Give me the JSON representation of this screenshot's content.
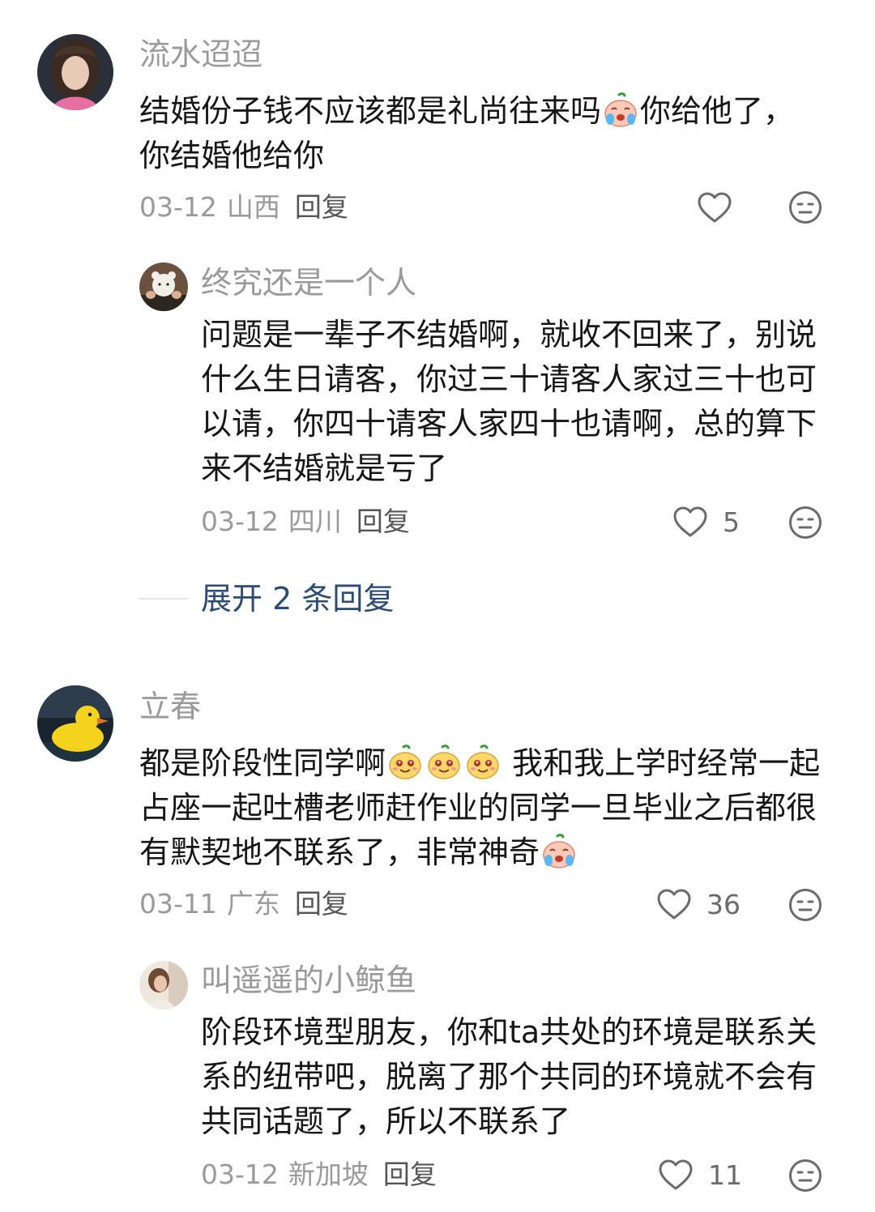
{
  "comments": [
    {
      "author": "流水迢迢",
      "text_a": "结婚份子钱不应该都是礼尚往来吗",
      "text_b": "你给他了，你结婚他给你",
      "date": "03-12",
      "location": "山西",
      "reply_label": "回复",
      "likes": "",
      "avatar_icon": "avatar-woman-portrait",
      "replies": [
        {
          "author": "终究还是一个人",
          "text": "问题是一辈子不结婚啊，就收不回来了，别说什么生日请客，你过三十请客人家过三十也可以请，你四十请客人家四十也请啊，总的算下来不结婚就是亏了",
          "date": "03-12",
          "location": "四川",
          "reply_label": "回复",
          "likes": "5",
          "avatar_icon": "avatar-bear-toy"
        }
      ],
      "expand_label": "展开 2 条回复"
    },
    {
      "author": "立春",
      "text_a": "都是阶段性同学啊",
      "text_b": " 我和我上学时经常一起占座一起吐槽老师赶作业的同学一旦毕业之后都很有默契地不联系了，非常神奇",
      "date": "03-11",
      "location": "广东",
      "reply_label": "回复",
      "likes": "36",
      "avatar_icon": "avatar-rubber-duck",
      "replies": [
        {
          "author": "叫遥遥的小鲸鱼",
          "text": "阶段环境型朋友，你和ta共处的环境是联系关系的纽带吧，脱离了那个共同的环境就不会有共同话题了，所以不联系了",
          "date": "03-12",
          "location": "新加坡",
          "reply_label": "回复",
          "likes": "11",
          "avatar_icon": "avatar-person-photo"
        }
      ]
    }
  ],
  "icons": {
    "like": "heart-outline-icon",
    "dislike": "meh-face-icon",
    "emoji_cry": "crying-peach-emoji-icon",
    "emoji_sly": "smirk-peach-emoji-icon"
  },
  "colors": {
    "name": "#9a9a9a",
    "text": "#161616",
    "link": "#2b4a74",
    "meta": "#9a9a9a"
  }
}
